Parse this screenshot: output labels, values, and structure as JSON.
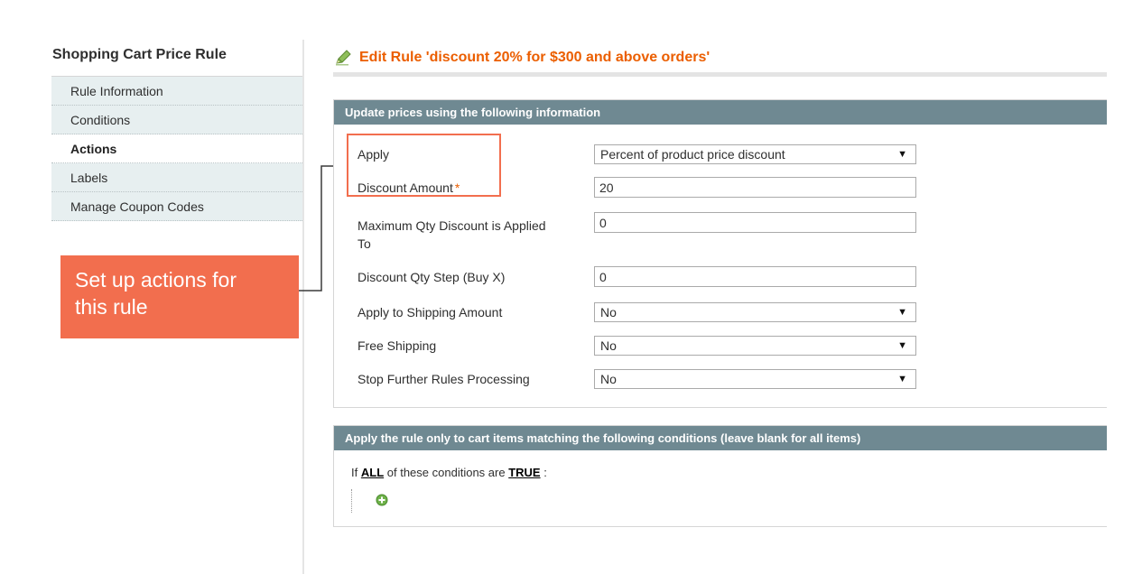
{
  "sidebar": {
    "title": "Shopping Cart Price Rule",
    "items": [
      {
        "label": "Rule Information",
        "active": false
      },
      {
        "label": "Conditions",
        "active": false
      },
      {
        "label": "Actions",
        "active": true
      },
      {
        "label": "Labels",
        "active": false
      },
      {
        "label": "Manage Coupon Codes",
        "active": false
      }
    ]
  },
  "callout": {
    "line1": "Set up actions for",
    "line2": "this rule"
  },
  "page": {
    "title": "Edit Rule 'discount 20% for $300 and above orders'"
  },
  "actions_box": {
    "header": "Update prices using the following information",
    "fields": {
      "apply": {
        "label": "Apply",
        "value": "Percent of product price discount"
      },
      "discount_amount": {
        "label": "Discount Amount",
        "required_mark": "*",
        "value": "20"
      },
      "max_qty": {
        "label_line1": "Maximum Qty Discount is Applied",
        "label_line2": "To",
        "value": "0"
      },
      "qty_step": {
        "label": "Discount Qty Step (Buy X)",
        "value": "0"
      },
      "apply_shipping": {
        "label": "Apply to Shipping Amount",
        "value": "No"
      },
      "free_shipping": {
        "label": "Free Shipping",
        "value": "No"
      },
      "stop_rules": {
        "label": "Stop Further Rules Processing",
        "value": "No"
      }
    }
  },
  "conditions_box": {
    "header": "Apply the rule only to cart items matching the following conditions (leave blank for all items)",
    "prefix": "If",
    "aggregator": "ALL",
    "middle": "of these conditions are",
    "value": "TRUE",
    "suffix": ":"
  },
  "icons": {
    "title_icon": "pencil-edit-icon",
    "add_icon": "add-condition-icon",
    "select_arrow": "▼"
  },
  "colors": {
    "accent": "#eb5e00",
    "callout": "#f26e4e",
    "header_bg": "#6f8992",
    "sidebar_bg": "#e7eff0"
  }
}
